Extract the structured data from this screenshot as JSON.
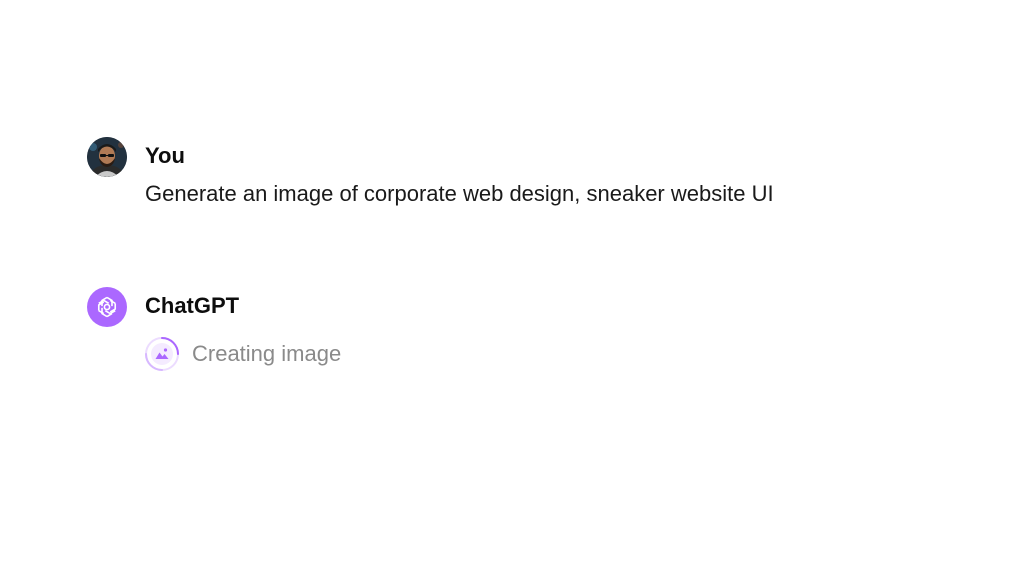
{
  "conversation": {
    "user_message": {
      "author": "You",
      "avatar_icon": "user-photo-avatar",
      "text": "Generate an image of corporate web design, sneaker website UI"
    },
    "assistant_message": {
      "author": "ChatGPT",
      "avatar_icon": "openai-logo-icon",
      "status_icon": "image-generation-spinner-icon",
      "status_text": "Creating image"
    }
  },
  "colors": {
    "background": "#ffffff",
    "assistant_avatar": "#ab68ff",
    "status_text": "#8a8a8a",
    "accent_purple": "#ab68ff"
  }
}
